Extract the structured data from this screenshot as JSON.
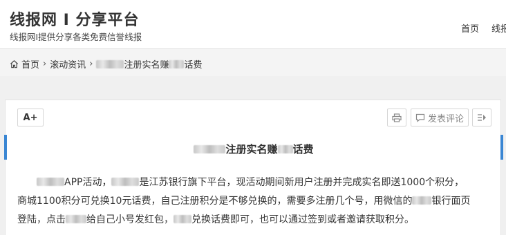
{
  "header": {
    "site_title": "线报网 I 分享平台",
    "site_desc": "线报网I提供分享各类免费信誉线报",
    "nav": [
      "首页",
      "线报"
    ]
  },
  "breadcrumb": {
    "home": "首页",
    "section": "滚动资讯",
    "current_suffix": "注册实名赚",
    "current_end": "话费"
  },
  "toolbar": {
    "font_label": "A+",
    "comment_label": "发表评论"
  },
  "article": {
    "title_part1": "注册实名赚",
    "title_part2": "话费",
    "p1_a": "APP活动，",
    "p1_b": "是江苏银行旗下平台，现活动期间新用户注册并完成实名即送1000个积分，",
    "p2_a": "商城1100积分可兑换10元话费，自己注册积分是不够兑换的，需要多注册几个号，用微信的",
    "p2_b": "银行面页",
    "p3_a": "登陆，点击",
    "p3_b": "给自己小号发红包，",
    "p3_c": "兑换话费即可，也可以通过签到或者邀请获取积分。"
  },
  "icons": {
    "home": "home-icon",
    "print": "printer-icon",
    "comment": "comment-icon",
    "next": "next-article-icon"
  },
  "colors": {
    "accent": "#3a86d3",
    "background": "#f0f0f0"
  }
}
